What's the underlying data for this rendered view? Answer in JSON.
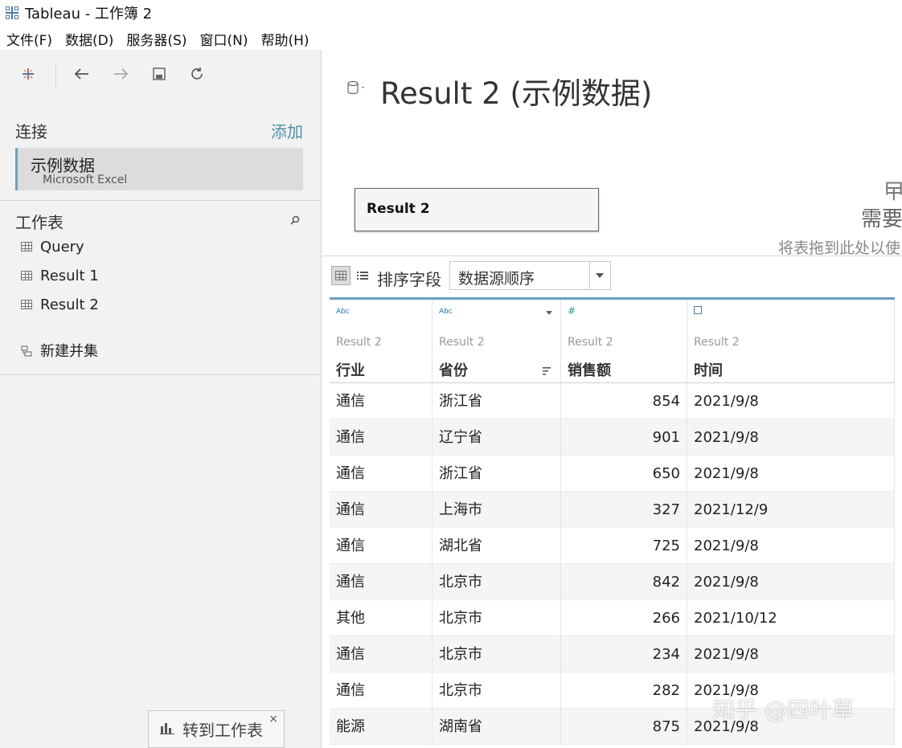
{
  "window": {
    "title": "Tableau - 工作簿 2"
  },
  "menu": [
    "文件(F)",
    "数据(D)",
    "服务器(S)",
    "窗口(N)",
    "帮助(H)"
  ],
  "left": {
    "connections_label": "连接",
    "add_label": "添加",
    "connection": {
      "name": "示例数据",
      "type": "Microsoft Excel"
    },
    "worksheets_label": "工作表",
    "sheets": [
      "Query",
      "Result 1",
      "Result 2"
    ],
    "new_union": "新建并集",
    "goto_label": "转到工作表",
    "goto_close": "×"
  },
  "main": {
    "title": "Result 2 (示例数据)",
    "table_tile": "Result 2",
    "drop_hint_1": "曱",
    "drop_hint_2": "需要",
    "drop_hint_3": "将表拖到此处以使",
    "sort_label": "排序字段",
    "sort_value": "数据源顺序"
  },
  "grid": {
    "columns": [
      {
        "type_label": "Abc",
        "type": "string",
        "source": "Result 2",
        "name": "行业"
      },
      {
        "type_label": "Abc",
        "type": "string",
        "source": "Result 2",
        "name": "省份"
      },
      {
        "type_label": "#",
        "type": "number",
        "source": "Result 2",
        "name": "销售额"
      },
      {
        "type_label": "",
        "type": "date",
        "source": "Result 2",
        "name": "时间"
      }
    ],
    "rows": [
      [
        "通信",
        "浙江省",
        "854",
        "2021/9/8"
      ],
      [
        "通信",
        "辽宁省",
        "901",
        "2021/9/8"
      ],
      [
        "通信",
        "浙江省",
        "650",
        "2021/9/8"
      ],
      [
        "通信",
        "上海市",
        "327",
        "2021/12/9"
      ],
      [
        "通信",
        "湖北省",
        "725",
        "2021/9/8"
      ],
      [
        "通信",
        "北京市",
        "842",
        "2021/9/8"
      ],
      [
        "其他",
        "北京市",
        "266",
        "2021/10/12"
      ],
      [
        "通信",
        "北京市",
        "234",
        "2021/9/8"
      ],
      [
        "通信",
        "北京市",
        "282",
        "2021/9/8"
      ],
      [
        "能源",
        "湖南省",
        "875",
        "2021/9/8"
      ]
    ]
  },
  "watermark": "知乎 @四叶草"
}
